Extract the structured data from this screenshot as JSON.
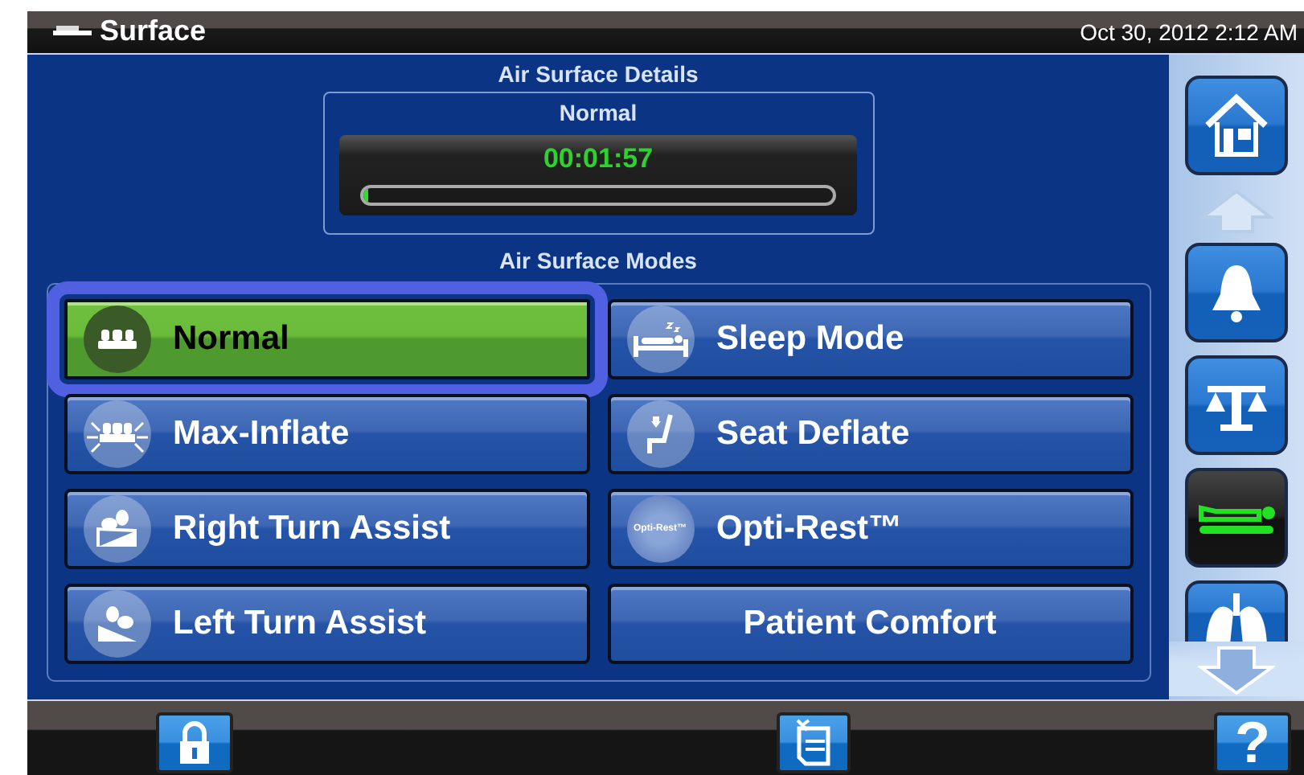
{
  "header": {
    "title": "Surface",
    "datetime": "Oct 30, 2012 2:12 AM"
  },
  "details": {
    "heading": "Air Surface Details",
    "mode": "Normal",
    "timer": "00:01:57",
    "level": 0.01
  },
  "modes": {
    "heading": "Air Surface Modes",
    "items": [
      {
        "label": "Normal",
        "kind": "normal",
        "selected": true
      },
      {
        "label": "Sleep Mode",
        "kind": "sleep",
        "selected": false
      },
      {
        "label": "Max-Inflate",
        "kind": "inflate",
        "selected": false
      },
      {
        "label": "Seat Deflate",
        "kind": "seat",
        "selected": false
      },
      {
        "label": "Right Turn Assist",
        "kind": "right",
        "selected": false
      },
      {
        "label": "Opti-Rest™",
        "kind": "logo",
        "logo_text": "Opti-Rest™",
        "selected": false
      },
      {
        "label": "Left Turn Assist",
        "kind": "left",
        "selected": false
      },
      {
        "label": "Patient Comfort",
        "kind": "plain",
        "selected": false
      }
    ]
  },
  "sidebar": [
    {
      "kind": "home",
      "selected": false
    },
    {
      "kind": "bell",
      "selected": false
    },
    {
      "kind": "scale",
      "selected": false
    },
    {
      "kind": "bed",
      "selected": true
    },
    {
      "kind": "lungs",
      "selected": false
    }
  ],
  "bottom_bar": [
    {
      "kind": "lock"
    },
    {
      "kind": "notes"
    },
    {
      "kind": "help",
      "label": "?"
    }
  ]
}
